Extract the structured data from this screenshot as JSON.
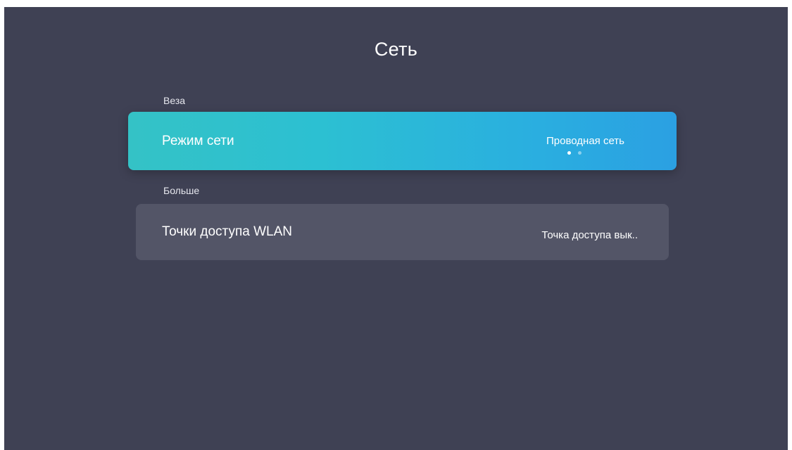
{
  "page": {
    "title": "Сеть"
  },
  "sections": {
    "basic_label": "Веза",
    "more_label": "Больше"
  },
  "rows": {
    "network_mode": {
      "label": "Режим сети",
      "value": "Проводная сеть",
      "pager_pages": 2,
      "pager_active": 1
    },
    "hotspot": {
      "label": "Точки доступа WLAN",
      "value": "Точка доступа вык.."
    }
  },
  "colors": {
    "background": "#3f4154",
    "selected_gradient_start": "#34c2c6",
    "selected_gradient_end": "#2ba0e2",
    "row_background": "#535567"
  }
}
